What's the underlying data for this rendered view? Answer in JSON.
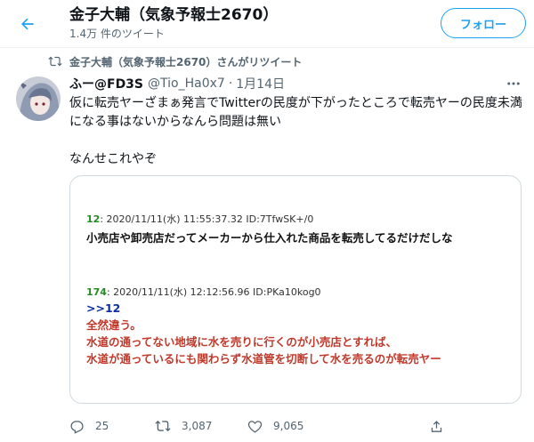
{
  "header": {
    "title": "金子大輔（気象予報士2670）",
    "subtitle": "1.4万 件のツイート",
    "follow_label": "フォロー"
  },
  "retweet_notice": "金子大輔（気象予報士2670）さんがリツイート",
  "tweet": {
    "author_name": "ふー@FD3S",
    "author_handle": "@Tio_Ha0x7",
    "separator": "·",
    "date": "1月14日",
    "text_lines": [
      "仮に転売ヤーざまぁ発言でTwitterの民度が下がったところで転売ヤーの民度未満になる事はないからなんら問題は無い",
      "なんせこれやぞ"
    ],
    "media": {
      "post1": {
        "number": "12",
        "meta": ": 2020/11/11(水) 11:55:37.32 ID:7TfwSK+/0",
        "body": "小売店や卸売店だってメーカーから仕入れた商品を転売してるだけだしな"
      },
      "post2": {
        "number": "174",
        "meta": ": 2020/11/11(水) 12:12:56.96 ID:PKa10kog0",
        "reply_ref": ">>12",
        "body_lines": [
          "全然違う。",
          "水道の通ってない地域に水を売りに行くのが小売店とすれば、",
          "水道が通っているにも関わらず水道管を切断して水を売るのが転売ヤー"
        ]
      }
    },
    "stats": {
      "replies": "25",
      "retweets": "3,087",
      "likes": "9,065"
    }
  },
  "colors": {
    "accent": "#1da1f2",
    "muted": "#536471",
    "post_number": "#228b22",
    "reply_ref": "#0a2fa0",
    "quote_red": "#c0392b"
  },
  "icons": [
    "back-arrow-icon",
    "retweet-icon",
    "more-icon",
    "reply-icon",
    "like-icon",
    "share-icon"
  ]
}
